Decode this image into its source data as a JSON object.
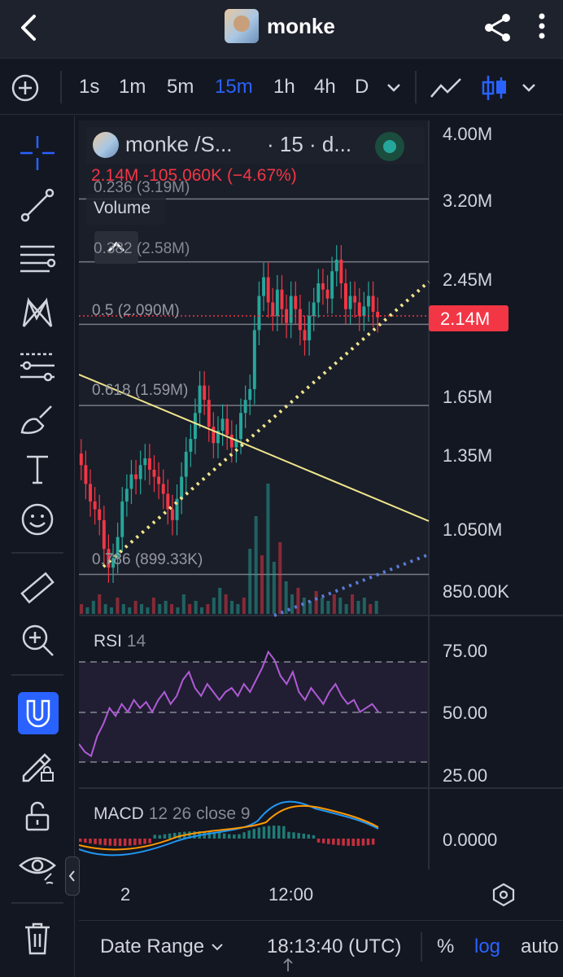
{
  "header": {
    "title": "monke",
    "avatar": "monkey-avatar",
    "back_icon": "back-arrow-icon",
    "share_icon": "share-icon",
    "more_icon": "more-vertical-icon"
  },
  "toolbar": {
    "timeframes": [
      "1s",
      "1m",
      "5m",
      "15m",
      "1h",
      "4h",
      "D"
    ],
    "active_timeframe": "15m",
    "accent_color": "#2962ff"
  },
  "legend": {
    "symbol": "monke /S...",
    "interval": "· 15 · d...",
    "status_color": "#26a69a",
    "price_change": "2.14M -105.060K (−4.67%)",
    "volume_label": "Volume"
  },
  "price_axis": [
    "4.00M",
    "3.20M",
    "2.45M",
    "2.14M",
    "1.65M",
    "1.35M",
    "1.050M",
    "850.00K"
  ],
  "current_price_tag": "2.14M",
  "fib_levels": [
    {
      "label": "0.236 (3.19M)"
    },
    {
      "label": "0.382 (2.58M)"
    },
    {
      "label": "0.5 (2.090M)"
    },
    {
      "label": "0.618 (1.59M)"
    },
    {
      "label": "0.786 (899.33K)"
    }
  ],
  "rsi": {
    "name": "RSI",
    "param": "14",
    "axis": [
      "75.00",
      "50.00",
      "25.00"
    ]
  },
  "macd": {
    "name": "MACD",
    "params": "12 26 close 9",
    "axis": [
      "0.0000"
    ]
  },
  "time_axis": [
    "2",
    "12:00"
  ],
  "bottombar": {
    "date_range": "Date Range",
    "time": "18:13:40 (UTC)",
    "percent": "%",
    "log": "log",
    "auto": "auto"
  },
  "colors": {
    "up": "#26a69a",
    "down": "#f23645",
    "rsi_line": "#b05bd6",
    "trend_yellow": "#f0e68c",
    "trend_blue": "#5b7bd6"
  },
  "chart_data": {
    "type": "candlestick",
    "candles_close": [
      1.3,
      1.22,
      1.15,
      1.12,
      1.08,
      0.98,
      0.92,
      0.95,
      1.02,
      1.15,
      1.2,
      1.26,
      1.24,
      1.3,
      1.33,
      1.28,
      1.25,
      1.22,
      1.18,
      1.12,
      1.08,
      1.16,
      1.25,
      1.36,
      1.42,
      1.55,
      1.7,
      1.62,
      1.48,
      1.4,
      1.46,
      1.52,
      1.44,
      1.38,
      1.42,
      1.55,
      1.62,
      1.68,
      2.05,
      2.3,
      2.45,
      2.25,
      2.15,
      2.35,
      2.2,
      2.1,
      2.3,
      2.2,
      2.05,
      1.98,
      2.15,
      2.25,
      2.4,
      2.35,
      2.28,
      2.5,
      2.6,
      2.4,
      2.2,
      2.3,
      2.25,
      2.15,
      2.22,
      2.3,
      2.18,
      2.14
    ],
    "rsi_values": [
      34,
      30,
      28,
      38,
      44,
      52,
      48,
      54,
      50,
      56,
      52,
      55,
      50,
      56,
      60,
      54,
      58,
      66,
      70,
      62,
      58,
      64,
      60,
      56,
      60,
      62,
      58,
      64,
      60,
      66,
      72,
      80,
      76,
      68,
      64,
      70,
      60,
      56,
      62,
      58,
      54,
      60,
      64,
      58,
      54,
      56,
      50,
      52,
      54,
      50
    ],
    "volume": [
      3,
      2,
      4,
      6,
      3,
      2,
      5,
      3,
      2,
      4,
      3,
      2,
      5,
      3,
      4,
      3,
      2,
      6,
      3,
      4,
      2,
      3,
      5,
      8,
      6,
      4,
      3,
      5,
      20,
      30,
      18,
      40,
      16,
      22,
      10,
      6,
      8,
      5,
      4,
      7,
      5,
      4,
      6,
      5,
      3,
      6,
      4,
      5,
      3,
      4
    ]
  }
}
